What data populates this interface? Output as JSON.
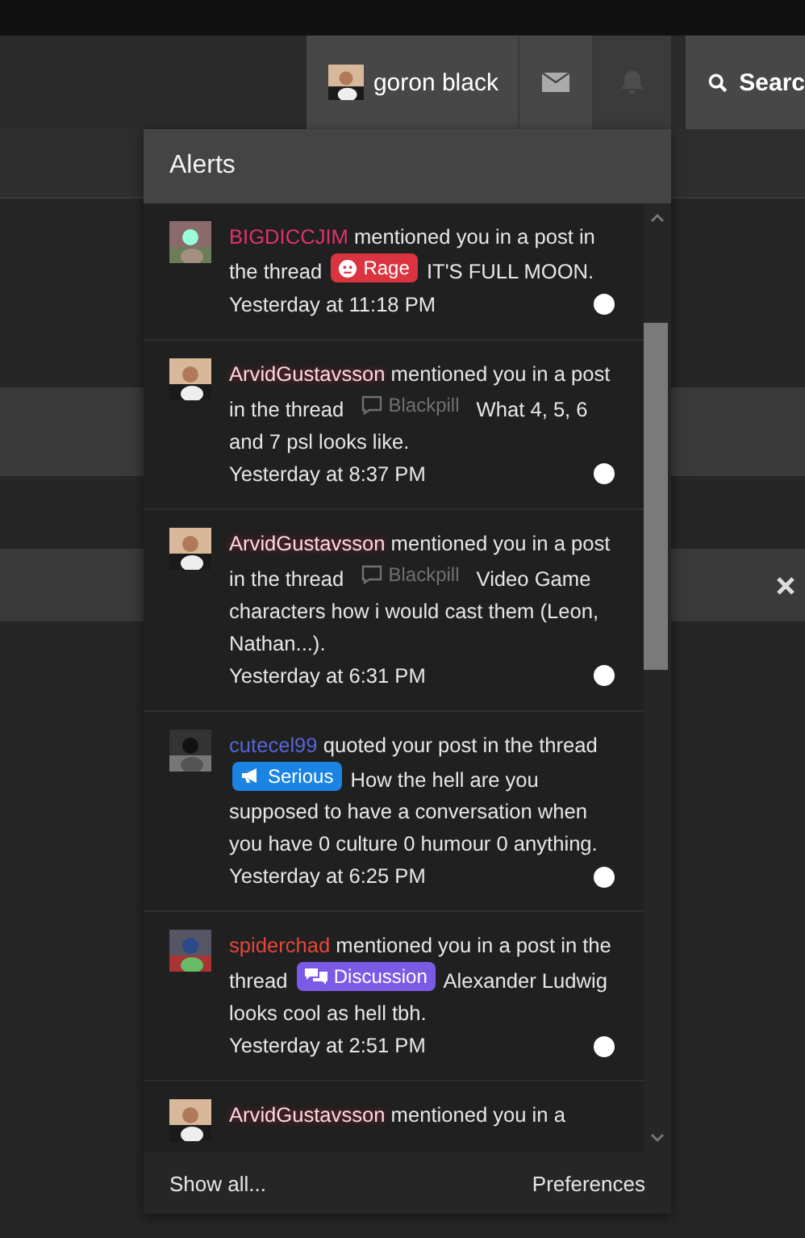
{
  "header": {
    "user": {
      "name": "goron black"
    },
    "search": {
      "label": "Searc"
    }
  },
  "alerts": {
    "title": "Alerts",
    "items": [
      {
        "user": "BIGDICCJIM",
        "color": "#e0336b",
        "glow": false,
        "action": "mentioned you in a post in the thread",
        "tag": {
          "label": "Rage",
          "kind": "rage",
          "color": "#d9343f"
        },
        "subject": "IT'S FULL MOON.",
        "time": "Yesterday at 11:18 PM",
        "unread": true
      },
      {
        "user": "ArvidGustavsson",
        "color": "#f3dde0",
        "glow": true,
        "action": "mentioned you in a post in the thread",
        "tag": {
          "label": "Blackpill",
          "kind": "plain",
          "color": "#707070"
        },
        "subject": "What 4, 5, 6 and 7 psl looks like.",
        "time": "Yesterday at 8:37 PM",
        "unread": true
      },
      {
        "user": "ArvidGustavsson",
        "color": "#f3dde0",
        "glow": true,
        "action": "mentioned you in a post in the thread",
        "tag": {
          "label": "Blackpill",
          "kind": "plain",
          "color": "#707070"
        },
        "subject": "Video Game characters how i would cast them (Leon, Nathan...).",
        "time": "Yesterday at 6:31 PM",
        "unread": true
      },
      {
        "user": "cutecel99",
        "color": "#5566d8",
        "glow": false,
        "action": "quoted your post in the thread",
        "tag": {
          "label": "Serious",
          "kind": "serious",
          "color": "#1b84e3"
        },
        "subject": "How the hell are you supposed to have a conversation when you have 0 culture 0 humour 0 anything.",
        "time": "Yesterday at 6:25 PM",
        "unread": true
      },
      {
        "user": "spiderchad",
        "color": "#e4473c",
        "glow": false,
        "action": "mentioned you in a post in the thread",
        "tag": {
          "label": "Discussion",
          "kind": "discussion",
          "color": "#7b5be6"
        },
        "subject": "Alexander Ludwig looks cool as hell tbh.",
        "time": "Yesterday at 2:51 PM",
        "unread": true
      },
      {
        "user": "ArvidGustavsson",
        "color": "#f3dde0",
        "glow": true,
        "action": "mentioned you in a"
      }
    ],
    "footer": {
      "show_all": "Show all...",
      "preferences": "Preferences"
    }
  }
}
